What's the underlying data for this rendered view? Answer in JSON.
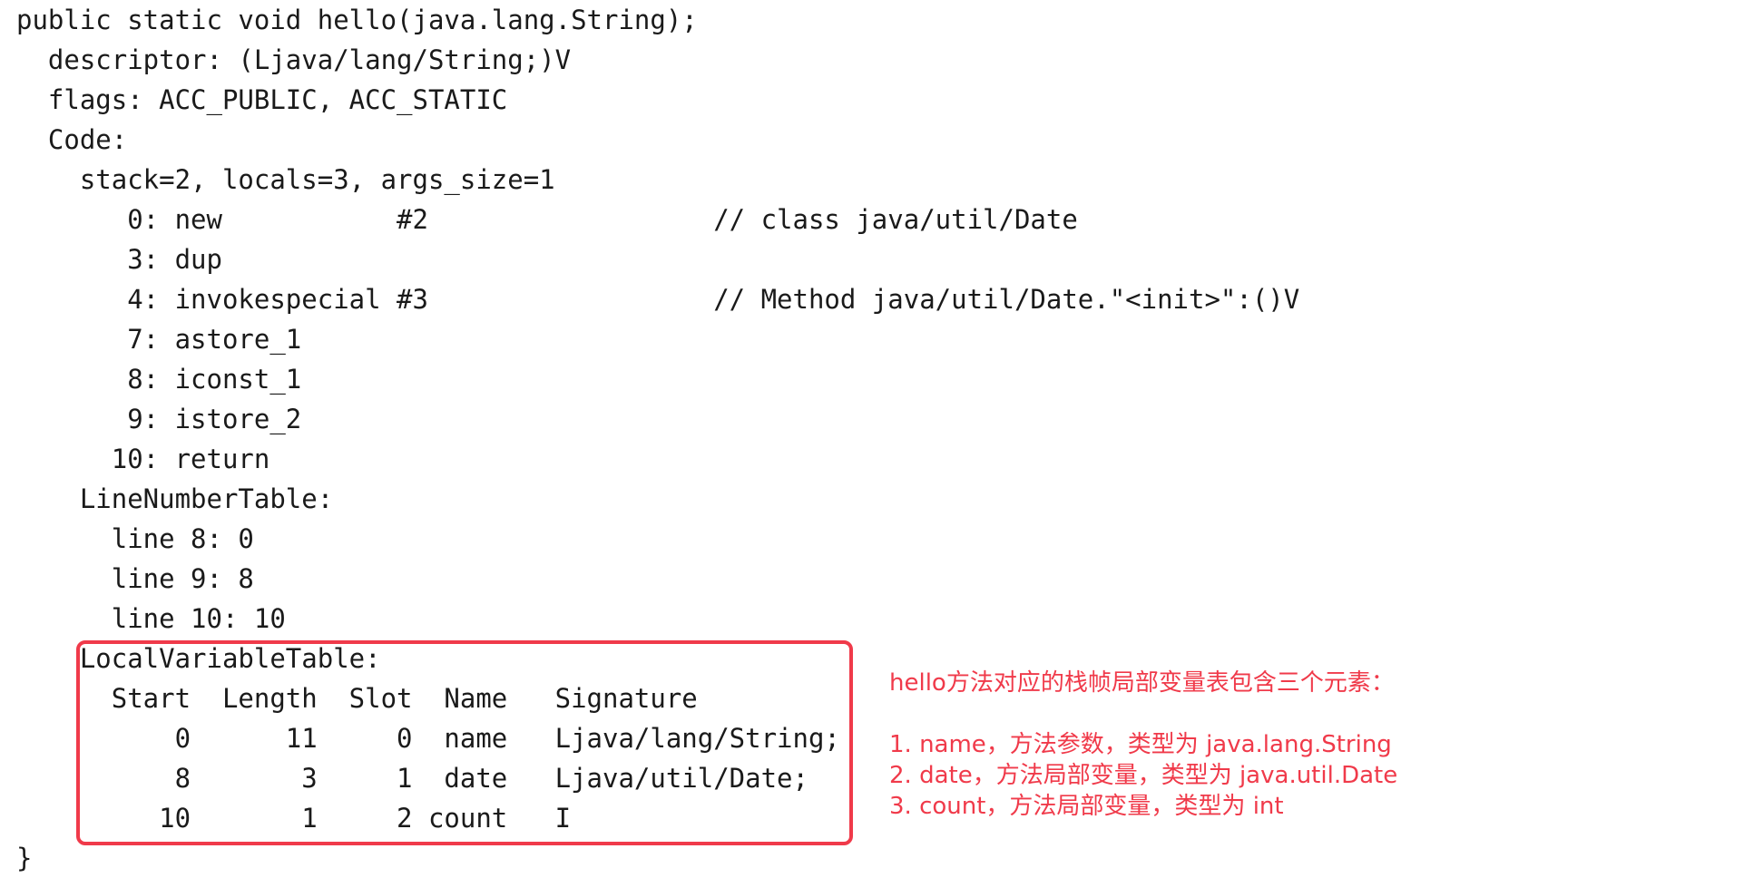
{
  "code": {
    "lines": [
      "public static void hello(java.lang.String);",
      "  descriptor: (Ljava/lang/String;)V",
      "  flags: ACC_PUBLIC, ACC_STATIC",
      "  Code:",
      "    stack=2, locals=3, args_size=1",
      "       0: new           #2                  // class java/util/Date",
      "       3: dup",
      "       4: invokespecial #3                  // Method java/util/Date.\"<init>\":()V",
      "       7: astore_1",
      "       8: iconst_1",
      "       9: istore_2",
      "      10: return",
      "    LineNumberTable:",
      "      line 8: 0",
      "      line 9: 8",
      "      line 10: 10",
      "    LocalVariableTable:",
      "      Start  Length  Slot  Name   Signature",
      "          0      11     0  name   Ljava/lang/String;",
      "          8       3     1  date   Ljava/util/Date;",
      "         10       1     2 count   I",
      "}"
    ]
  },
  "annotation": {
    "title": "hello方法对应的栈帧局部变量表包含三个元素：",
    "items": [
      "1. name，方法参数，类型为 java.lang.String",
      "2. date，方法局部变量，类型为 java.util.Date",
      "3. count，方法局部变量，类型为 int"
    ],
    "color": "#f03a4a"
  }
}
